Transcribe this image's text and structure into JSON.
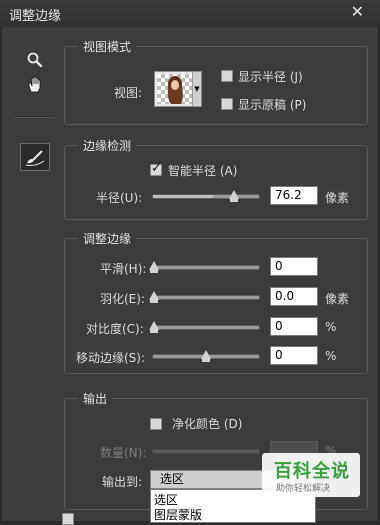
{
  "window": {
    "title": "调整边缘",
    "close_glyph": "✕"
  },
  "tools": [
    {
      "name": "zoom-tool",
      "icon": "magnifier-icon"
    },
    {
      "name": "hand-tool",
      "icon": "hand-icon"
    },
    {
      "name": "refine-radius-tool",
      "icon": "brush-icon"
    }
  ],
  "view_mode": {
    "legend": "视图模式",
    "view_label": "视图:",
    "show_radius": "显示半径 (J)",
    "show_original": "显示原稿 (P)"
  },
  "edge_detection": {
    "legend": "边缘检测",
    "smart_radius": "智能半径 (A)",
    "radius_label": "半径(U):",
    "radius_value": "76.2",
    "radius_unit": "像素",
    "radius_slider": 0.57
  },
  "adjust_edge": {
    "legend": "调整边缘",
    "smooth_label": "平滑(H):",
    "smooth_value": "0",
    "feather_label": "羽化(E):",
    "feather_value": "0.0",
    "feather_unit": "像素",
    "contrast_label": "对比度(C):",
    "contrast_value": "0",
    "contrast_unit": "%",
    "shift_label": "移动边缘(S):",
    "shift_value": "0",
    "shift_unit": "%",
    "shift_slider": 0.5
  },
  "output": {
    "legend": "输出",
    "decontaminate": "净化颜色 (D)",
    "amount_label": "数量(N):",
    "amount_unit": "%",
    "output_to_label": "输出到:",
    "output_to_value": "选区",
    "options": [
      "选区",
      "图层蒙版"
    ]
  },
  "watermark": {
    "main": "百科全说",
    "sub": "助你轻松解决"
  },
  "colors": {
    "background": "#3c3c3c",
    "title_bar": "#333333",
    "watermark_green": "#37a03c"
  }
}
